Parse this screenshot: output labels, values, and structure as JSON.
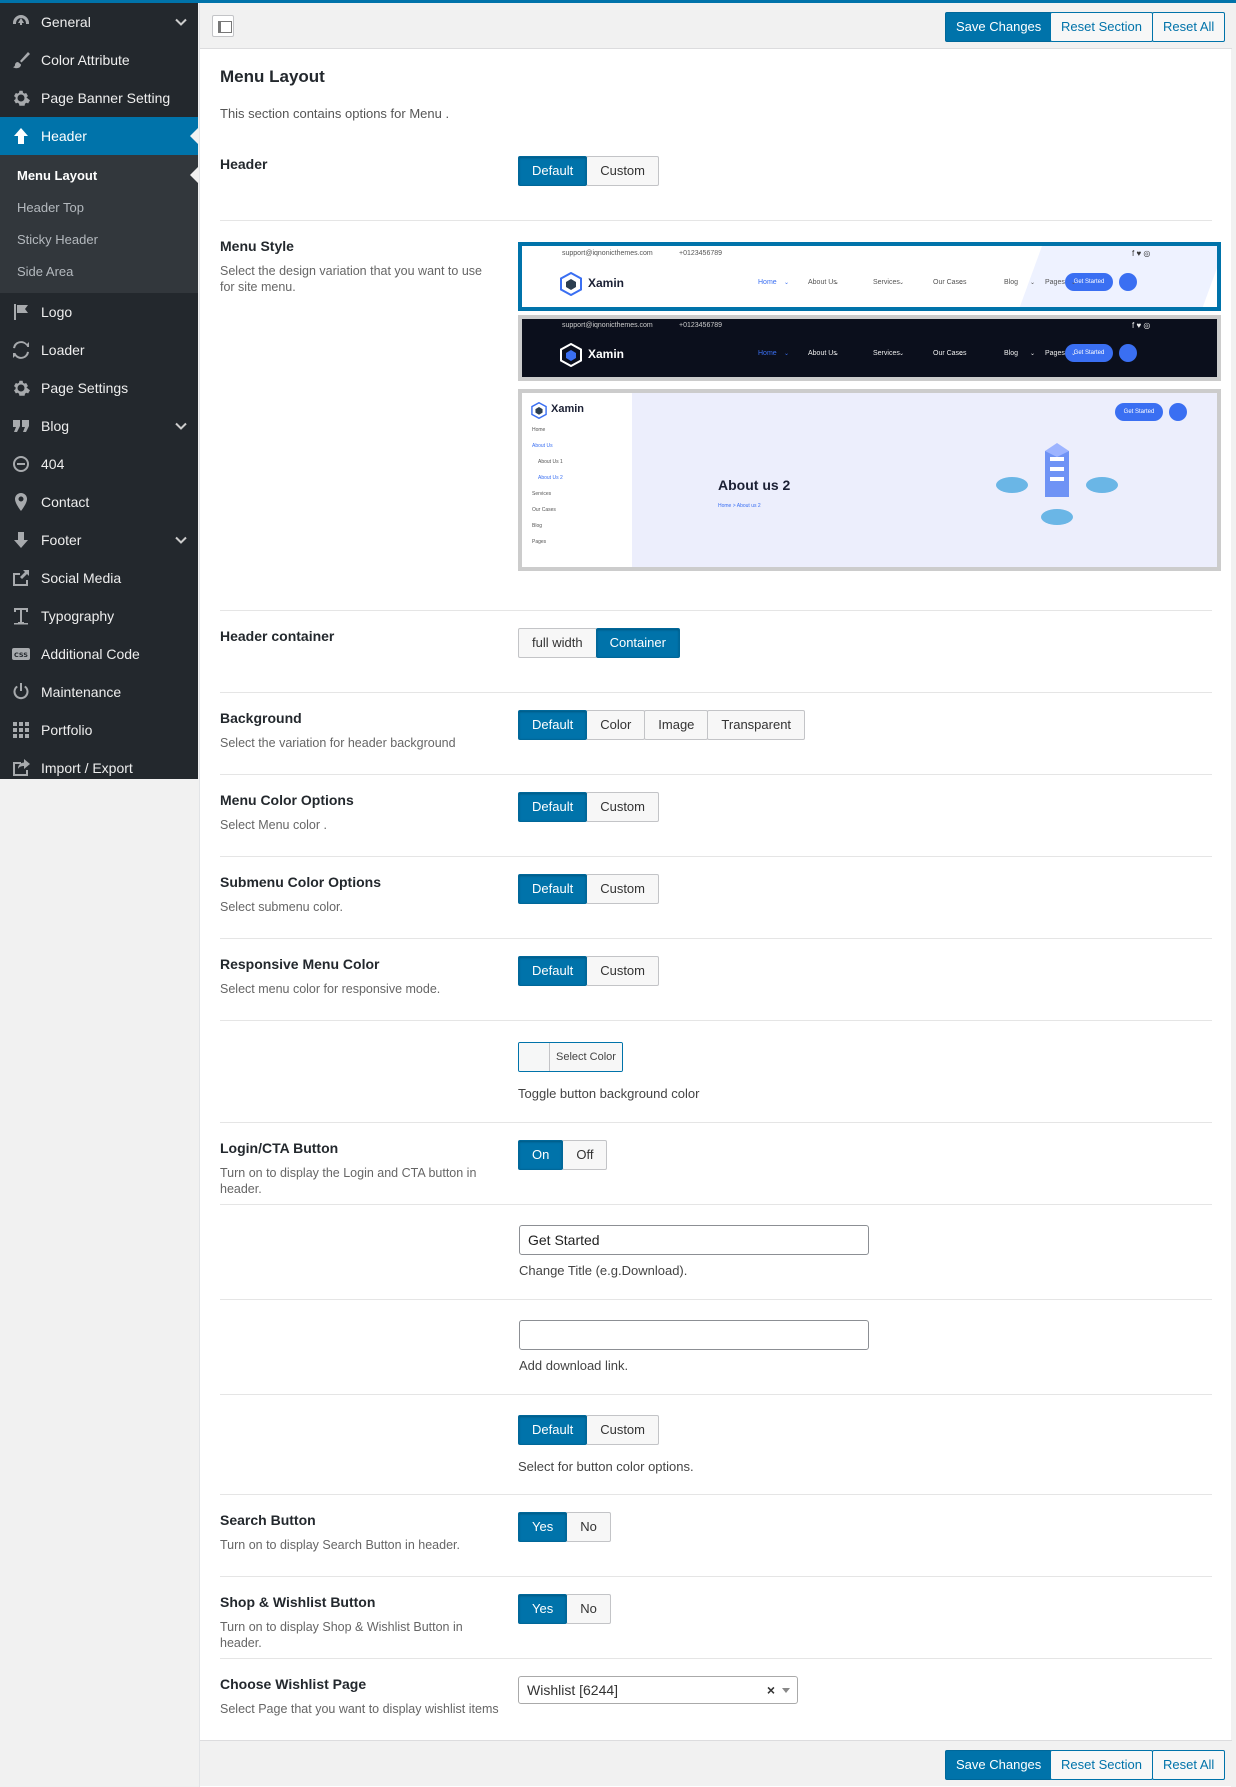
{
  "sidebar": {
    "items": [
      {
        "label": "General",
        "icon": "dashboard-icon",
        "chevron": true
      },
      {
        "label": "Color Attribute",
        "icon": "brush-icon"
      },
      {
        "label": "Page Banner Setting",
        "icon": "gear-icon"
      },
      {
        "label": "Header",
        "icon": "arrow-up-icon",
        "active": true
      },
      {
        "label": "Logo",
        "icon": "flag-icon"
      },
      {
        "label": "Loader",
        "icon": "refresh-icon"
      },
      {
        "label": "Page Settings",
        "icon": "gear-icon"
      },
      {
        "label": "Blog",
        "icon": "quote-icon",
        "chevron": true
      },
      {
        "label": "404",
        "icon": "minus-circle-icon"
      },
      {
        "label": "Contact",
        "icon": "location-pin-icon"
      },
      {
        "label": "Footer",
        "icon": "arrow-down-icon",
        "chevron": true
      },
      {
        "label": "Social Media",
        "icon": "share-icon"
      },
      {
        "label": "Typography",
        "icon": "text-icon"
      },
      {
        "label": "Additional Code",
        "icon": "css-icon"
      },
      {
        "label": "Maintenance",
        "icon": "power-icon"
      },
      {
        "label": "Portfolio",
        "icon": "grid-icon"
      },
      {
        "label": "Import / Export",
        "icon": "export-icon"
      }
    ],
    "header_submenu": [
      "Menu Layout",
      "Header Top",
      "Sticky Header",
      "Side Area"
    ]
  },
  "toolbar": {
    "save_label": "Save Changes",
    "reset_section_label": "Reset Section",
    "reset_all_label": "Reset All"
  },
  "section": {
    "title": "Menu Layout",
    "description": "This section contains options for Menu ."
  },
  "fields": {
    "header": {
      "title": "Header",
      "options": [
        "Default",
        "Custom"
      ],
      "selected": 0
    },
    "menu_style": {
      "title": "Menu Style",
      "description": "Select the design variation that you want to use for site menu.",
      "selected": 0
    },
    "header_container": {
      "title": "Header container",
      "options": [
        "full width",
        "Container"
      ],
      "selected": 1
    },
    "background": {
      "title": "Background",
      "description": "Select the variation for header background",
      "options": [
        "Default",
        "Color",
        "Image",
        "Transparent"
      ],
      "selected": 0
    },
    "menu_color": {
      "title": "Menu Color Options",
      "description": "Select Menu color .",
      "options": [
        "Default",
        "Custom"
      ],
      "selected": 0
    },
    "submenu_color": {
      "title": "Submenu Color Options",
      "description": "Select submenu color.",
      "options": [
        "Default",
        "Custom"
      ],
      "selected": 0
    },
    "responsive_menu_color": {
      "title": "Responsive Menu Color",
      "description": "Select menu color for responsive mode.",
      "options": [
        "Default",
        "Custom"
      ],
      "selected": 0
    },
    "toggle_bg": {
      "button_label": "Select Color",
      "description": "Toggle button background color"
    },
    "login_cta": {
      "title": "Login/CTA Button",
      "description": "Turn on to display the Login and CTA button in header.",
      "options": [
        "On",
        "Off"
      ],
      "selected": 0
    },
    "cta_title": {
      "value": "Get Started",
      "description": "Change Title (e.g.Download)."
    },
    "download_link": {
      "value": "",
      "description": "Add download link."
    },
    "button_color": {
      "options": [
        "Default",
        "Custom"
      ],
      "selected": 0,
      "description": "Select for button color options."
    },
    "search_button": {
      "title": "Search Button",
      "description": "Turn on to display Search Button in header.",
      "options": [
        "Yes",
        "No"
      ],
      "selected": 0
    },
    "shop_wishlist": {
      "title": "Shop & Wishlist Button",
      "description": "Turn on to display Shop & Wishlist Button in header.",
      "options": [
        "Yes",
        "No"
      ],
      "selected": 0
    },
    "wishlist_page": {
      "title": "Choose Wishlist Page",
      "description": "Select Page that you want to display wishlist items",
      "value": "Wishlist [6244]",
      "clear": "×"
    }
  },
  "previews": {
    "email": "support@iqnonicthemes.com",
    "phone": "+0123456789",
    "brand": "Xamin",
    "nav": [
      "Home",
      "About Us",
      "Services",
      "Our Cases",
      "Blog",
      "Pages"
    ],
    "cta": "Get Started",
    "side_nav": [
      "Home",
      "About Us",
      "About Us 1",
      "About Us 2",
      "Services",
      "Our Cases",
      "Blog",
      "Pages"
    ],
    "page_title": "About us 2",
    "crumbs": "Home  >  About us 2"
  },
  "colors": {
    "accent": "#0073aa",
    "sidebar_bg": "#23282d",
    "preview_blue": "#3a6ff2"
  }
}
